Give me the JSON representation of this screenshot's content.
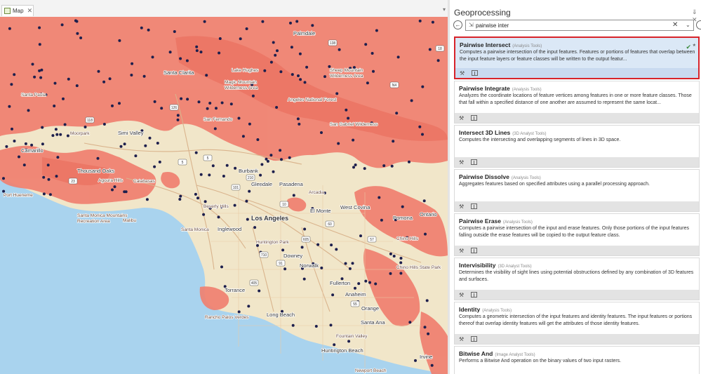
{
  "map": {
    "tab_label": "Map",
    "close_glyph": "✕",
    "dropdown_glyph": "▾",
    "places": [
      {
        "name": "Palmdale",
        "cls": "mid"
      },
      {
        "name": "Santa Clarita",
        "cls": "mid"
      },
      {
        "name": "Lake Hughes",
        "cls": "small"
      },
      {
        "name": "Santa Paula",
        "cls": "small"
      },
      {
        "name": "Moorpark",
        "cls": "small"
      },
      {
        "name": "Simi Valley",
        "cls": "mid"
      },
      {
        "name": "San Fernando",
        "cls": "small"
      },
      {
        "name": "Camarillo",
        "cls": "mid"
      },
      {
        "name": "Thousand Oaks",
        "cls": "mid"
      },
      {
        "name": "Calabasas",
        "cls": "small"
      },
      {
        "name": "Agoura Hills",
        "cls": "small"
      },
      {
        "name": "Burbank",
        "cls": "mid"
      },
      {
        "name": "Glendale",
        "cls": "mid"
      },
      {
        "name": "Pasadena",
        "cls": "mid"
      },
      {
        "name": "Arcadia",
        "cls": "small"
      },
      {
        "name": "Beverly Hills",
        "cls": "small"
      },
      {
        "name": "El Monte",
        "cls": "mid"
      },
      {
        "name": "West Covina",
        "cls": "mid"
      },
      {
        "name": "Los Angeles",
        "cls": "big"
      },
      {
        "name": "Santa Monica",
        "cls": "small"
      },
      {
        "name": "Inglewood",
        "cls": "mid"
      },
      {
        "name": "Huntington Park",
        "cls": "small"
      },
      {
        "name": "Downey",
        "cls": "mid"
      },
      {
        "name": "Norwalk",
        "cls": "mid"
      },
      {
        "name": "Pomona",
        "cls": "mid"
      },
      {
        "name": "Ontario",
        "cls": "mid"
      },
      {
        "name": "Chino Hills",
        "cls": "small"
      },
      {
        "name": "Chino Hills State Park",
        "cls": "small"
      },
      {
        "name": "Torrance",
        "cls": "mid"
      },
      {
        "name": "Fullerton",
        "cls": "mid"
      },
      {
        "name": "Anaheim",
        "cls": "mid"
      },
      {
        "name": "Orange",
        "cls": "mid"
      },
      {
        "name": "Rancho Palos Verdes",
        "cls": "small"
      },
      {
        "name": "Long Beach",
        "cls": "mid"
      },
      {
        "name": "Santa Ana",
        "cls": "mid"
      },
      {
        "name": "Fountain Valley",
        "cls": "small"
      },
      {
        "name": "Huntington Beach",
        "cls": "mid"
      },
      {
        "name": "Newport Beach",
        "cls": "small"
      },
      {
        "name": "Irvine",
        "cls": "mid"
      },
      {
        "name": "Santa Monica Mountains Recreation Area",
        "cls": "small"
      },
      {
        "name": "Malibu",
        "cls": "small"
      },
      {
        "name": "Port Hueneme",
        "cls": "small"
      },
      {
        "name": "Angeles National Forest",
        "cls": "small"
      },
      {
        "name": "Sheep Mountain Wilderness Area",
        "cls": "small"
      },
      {
        "name": "San Gabriel Wilderness",
        "cls": "small"
      },
      {
        "name": "Magic Mountain Wilderness Area",
        "cls": "small"
      }
    ],
    "shields": [
      "138",
      "18",
      "126",
      "N4",
      "118",
      "5",
      "5",
      "101",
      "210",
      "23",
      "605",
      "91",
      "405",
      "55",
      "710",
      "10",
      "60",
      "57"
    ]
  },
  "gp": {
    "title": "Geoprocessing",
    "pin_glyph": "⇓ ✕",
    "back_glyph": "←",
    "search": {
      "value": "pairwise inter",
      "clear_glyph": "✕",
      "dropdown_glyph": "⌄"
    },
    "results": [
      {
        "name": "Pairwise Intersect",
        "toolbox": "(Analysis Tools)",
        "desc": "Computes a pairwise intersection of the input features. Features or portions of features that overlap between the input feature layers or feature classes will be written to the output featur...",
        "selected": true
      },
      {
        "name": "Pairwise Integrate",
        "toolbox": "(Analysis Tools)",
        "desc": "Analyzes the coordinate locations of feature vertices among features in one or more feature classes. Those that fall within a specified distance of one another are assumed to represent the same locat...",
        "selected": false
      },
      {
        "name": "Intersect 3D Lines",
        "toolbox": "(3D Analyst Tools)",
        "desc": "Computes the intersecting and overlapping segments of lines in 3D space.",
        "selected": false
      },
      {
        "name": "Pairwise Dissolve",
        "toolbox": "(Analysis Tools)",
        "desc": "Aggregates features based on specified attributes using a parallel processing approach.",
        "selected": false
      },
      {
        "name": "Pairwise Erase",
        "toolbox": "(Analysis Tools)",
        "desc": "Computes a pairwise intersection of the input and erase features. Only those portions of the input features falling outside the erase features will be copied to the output feature class.",
        "selected": false
      },
      {
        "name": "Intervisibility",
        "toolbox": "(3D Analyst Tools)",
        "desc": "Determines the visibility of sight lines using  potential obstructions defined by any combination of 3D features and surfaces.",
        "selected": false
      },
      {
        "name": "Identity",
        "toolbox": "(Analysis Tools)",
        "desc": "Computes a geometric intersection of the input features and identity features. The input features or portions thereof that overlap identity features will get the attributes of those identity features.",
        "selected": false
      },
      {
        "name": "Bitwise And",
        "toolbox": "(Image Analyst Tools)",
        "desc": "Performs a Bitwise And operation on the binary values of two input rasters.",
        "selected": false
      }
    ],
    "selected_check_glyph": "✔",
    "tool_glyph": "⚒"
  },
  "colors": {
    "fire_zone": "#f08070",
    "urban": "#f1e6c9",
    "ocean": "#a9d3ee",
    "point": "#1d1f4d",
    "highlight": "#d8232a"
  }
}
